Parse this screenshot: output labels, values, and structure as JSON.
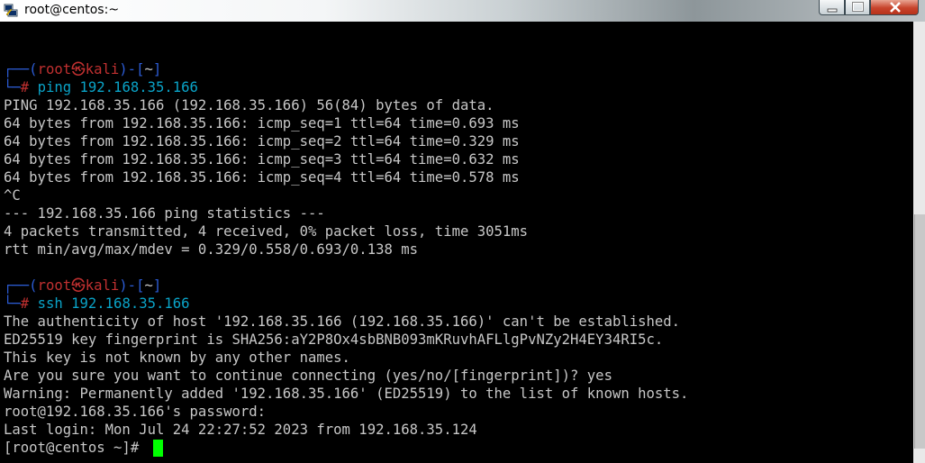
{
  "window": {
    "title": "root@centos:~",
    "icon": "putty-icon",
    "controls": [
      "minimize-icon",
      "maximize-icon",
      "close-icon"
    ]
  },
  "colors": {
    "background": "#000000",
    "text": "#c7c7c7",
    "prompt_frame": "#2c5cd5",
    "prompt_user": "#c03030",
    "command": "#0aa3c7",
    "cursor": "#00ff00"
  },
  "terminal": {
    "prompt1": {
      "frame_top": "┌──(",
      "user": "root",
      "skull": "㉿",
      "host": "kali",
      "frame_mid": ")-[",
      "dir": "~",
      "frame_end": "]",
      "frame_bottom": "└─",
      "hash": "#",
      "command": "ping 192.168.35.166"
    },
    "ping_output": [
      "PING 192.168.35.166 (192.168.35.166) 56(84) bytes of data.",
      "64 bytes from 192.168.35.166: icmp_seq=1 ttl=64 time=0.693 ms",
      "64 bytes from 192.168.35.166: icmp_seq=2 ttl=64 time=0.329 ms",
      "64 bytes from 192.168.35.166: icmp_seq=3 ttl=64 time=0.632 ms",
      "64 bytes from 192.168.35.166: icmp_seq=4 ttl=64 time=0.578 ms",
      "^C",
      "--- 192.168.35.166 ping statistics ---",
      "4 packets transmitted, 4 received, 0% packet loss, time 3051ms",
      "rtt min/avg/max/mdev = 0.329/0.558/0.693/0.138 ms"
    ],
    "prompt2": {
      "frame_top": "┌──(",
      "user": "root",
      "skull": "㉿",
      "host": "kali",
      "frame_mid": ")-[",
      "dir": "~",
      "frame_end": "]",
      "frame_bottom": "└─",
      "hash": "#",
      "command": "ssh 192.168.35.166"
    },
    "ssh_output": [
      "The authenticity of host '192.168.35.166 (192.168.35.166)' can't be established.",
      "ED25519 key fingerprint is SHA256:aY2P8Ox4sbBNB093mKRuvhAFLlgPvNZy2H4EY34RI5c.",
      "This key is not known by any other names.",
      "Are you sure you want to continue connecting (yes/no/[fingerprint])? yes",
      "Warning: Permanently added '192.168.35.166' (ED25519) to the list of known hosts.",
      "root@192.168.35.166's password:",
      "Last login: Mon Jul 24 22:27:52 2023 from 192.168.35.124"
    ],
    "final_prompt": "[root@centos ~]# "
  }
}
